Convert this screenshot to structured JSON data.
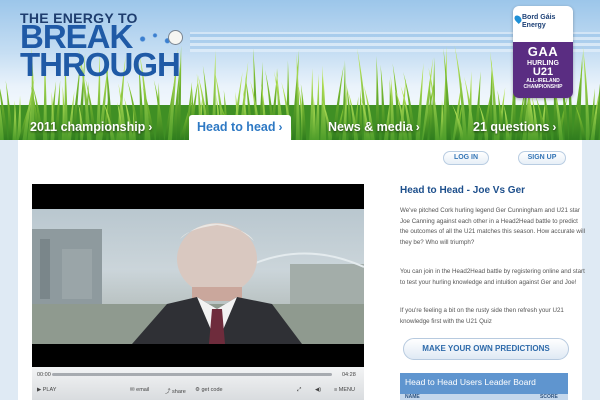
{
  "logo": {
    "line1": "THE ENERGY TO",
    "line2": "BREAK",
    "line3": "THROUGH"
  },
  "badge": {
    "sponsor": "Bord Gáis Energy",
    "gaa": "GAA",
    "sport": "HURLING",
    "grade": "U21",
    "competition": "ALL-IRELAND CHAMPIONSHIP"
  },
  "nav": {
    "items": [
      {
        "label": "2011 championship",
        "active": false
      },
      {
        "label": "Head to head",
        "active": true
      },
      {
        "label": "News & media",
        "active": false
      },
      {
        "label": "21 questions",
        "active": false
      }
    ]
  },
  "account": {
    "login": "LOG IN",
    "signup": "SIGN UP"
  },
  "player": {
    "time_current": "00:00",
    "time_total": "04:28",
    "play": "PLAY",
    "email": "email",
    "share": "share",
    "get_code": "get code",
    "menu": "MENU"
  },
  "article": {
    "title": "Head to Head - Joe Vs Ger",
    "para1": "We've pitched Cork hurling legend Ger Cunningham and U21 star Joe Canning against each other in a Head2Head battle to predict the outcomes of all the U21 matches this season. How accurate will they be? Who will triumph?",
    "para2": "You can join in the Head2Head battle by registering online and start to test your hurling knowledge and intuition against Ger and Joe!",
    "para3": "If you're feeling a bit on the rusty side then refresh your U21 knowledge first with the U21 Quiz",
    "predict_button": "MAKE YOUR OWN PREDICTIONS"
  },
  "leaderboard": {
    "title": "Head to Head Users Leader Board",
    "columns": [
      "NAME",
      "SCORE"
    ]
  },
  "colors": {
    "brand_blue": "#1f5aa6",
    "nav_active": "#2e79c4",
    "gaa_purple": "#5a2d82",
    "leader_blue": "#5f95cf"
  }
}
